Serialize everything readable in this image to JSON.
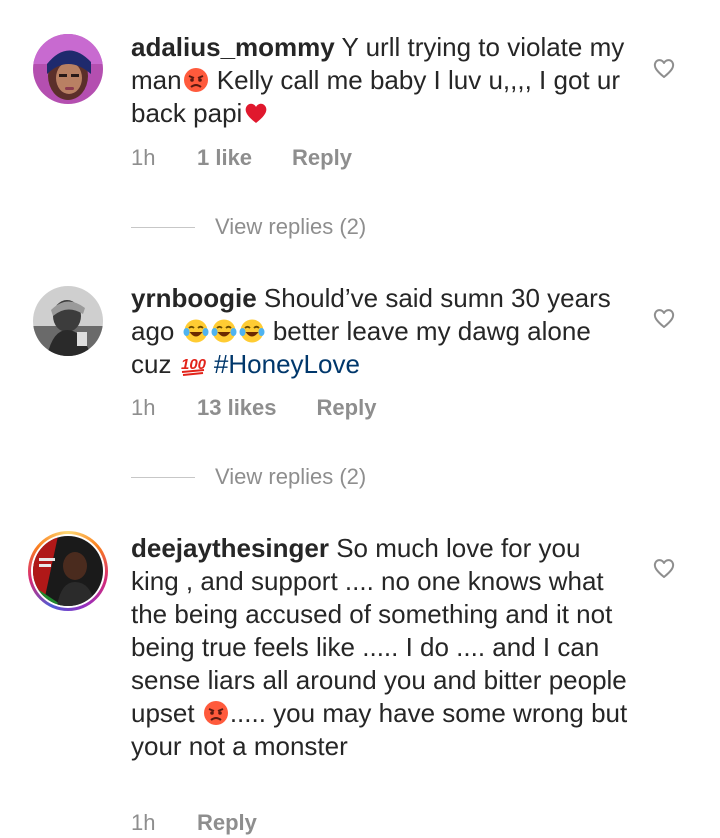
{
  "comments": [
    {
      "username": "adalius_mommy",
      "text_a": " Y urll trying to violate my man",
      "text_b": " Kelly call me baby I luv u,,,, I got ur back papi",
      "time": "1h",
      "likes": "1 like",
      "reply_label": "Reply",
      "view_replies": "View replies (2)"
    },
    {
      "username": "yrnboogie",
      "text_a": " Should’ve said sumn 30 years ago ",
      "text_b": " better leave my dawg alone cuz ",
      "hashtag": "#HoneyLove",
      "time": "1h",
      "likes": "13 likes",
      "reply_label": "Reply",
      "view_replies": "View replies (2)"
    },
    {
      "username": "deejaythesinger",
      "text_a": " So much love for you king , and support .... no one knows what the being accused of something and it not being true feels like ..... I do .... and I can sense liars all around you and bitter people upset ",
      "text_b": "..... you may have some wrong but your not a monster",
      "time": "1h",
      "reply_label": "Reply"
    }
  ],
  "icons": {
    "like": "heart-outline-icon",
    "angry": "angry-face-emoji",
    "heart": "red-heart-emoji",
    "laugh": "tears-of-joy-emoji",
    "hundred": "hundred-points-emoji"
  },
  "colors": {
    "text": "#262626",
    "secondary": "#8e8e8e",
    "hashtag": "#00376b",
    "heart": "#ed4956"
  }
}
